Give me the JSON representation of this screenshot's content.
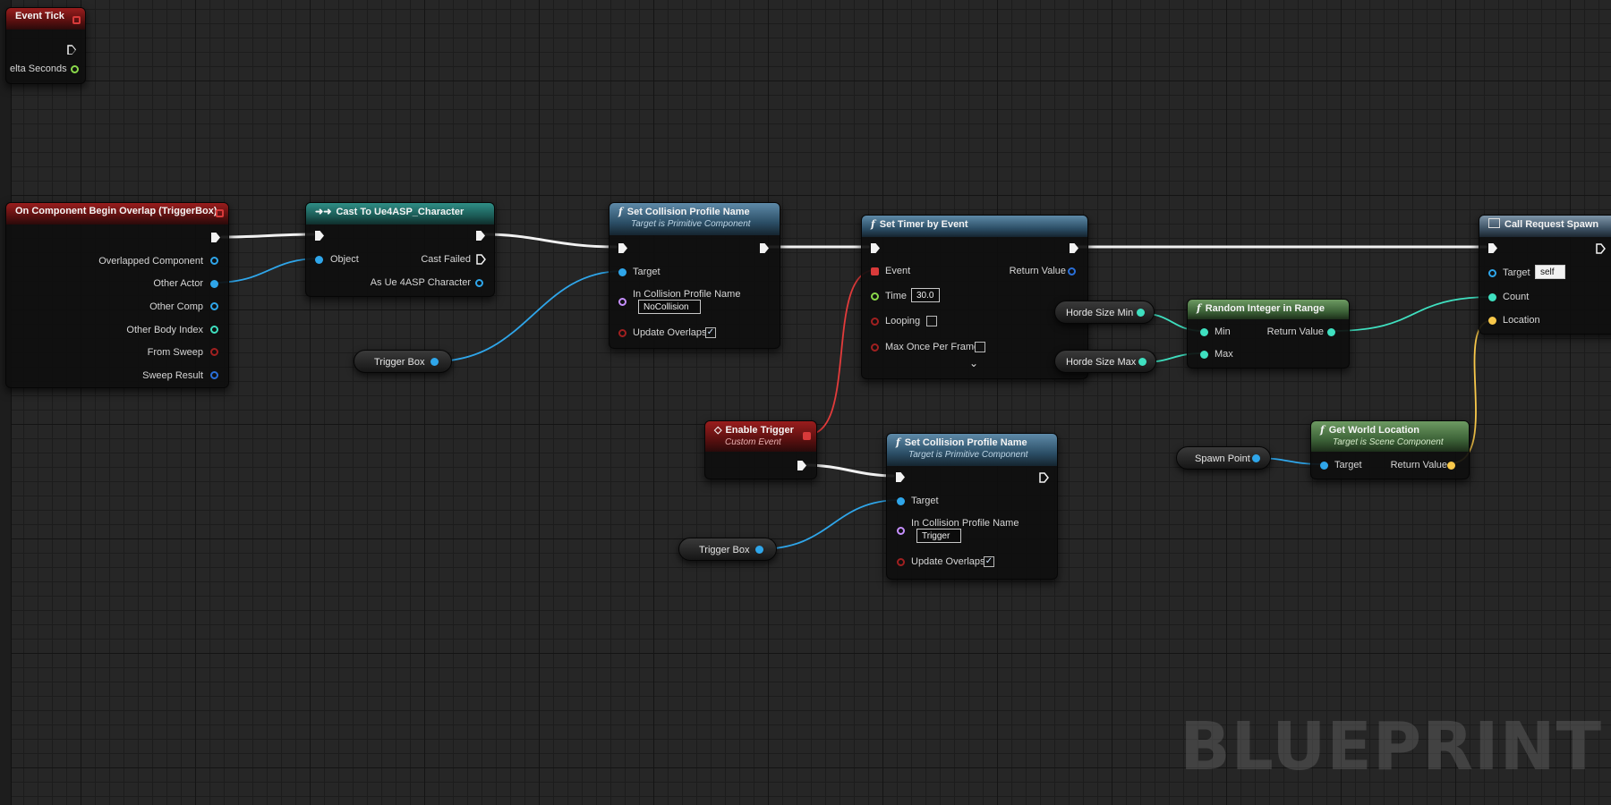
{
  "colors": {
    "exec": "#f2f2f2",
    "object": "#2fa6ea",
    "int": "#3fe0c0",
    "bool": "#a02020",
    "vector": "#f8c84a",
    "name": "#c690ff",
    "float": "#8ad84a",
    "delegate": "#e23b3b",
    "struct": "#2a6fd8"
  },
  "nodes": {
    "event_tick": {
      "title": "Event Tick",
      "pin_delta": "elta Seconds"
    },
    "overlap": {
      "title": "On Component Begin Overlap (TriggerBox)",
      "pins": [
        "Overlapped Component",
        "Other Actor",
        "Other Comp",
        "Other Body Index",
        "From Sweep",
        "Sweep Result"
      ]
    },
    "cast": {
      "title": "Cast To Ue4ASP_Character",
      "object": "Object",
      "cast_failed": "Cast Failed",
      "as_char": "As Ue 4ASP Character"
    },
    "set_collision_1": {
      "title": "Set Collision Profile Name",
      "subtitle": "Target is Primitive Component",
      "target": "Target",
      "profile_label": "In Collision Profile Name",
      "profile_value": "NoCollision",
      "update": "Update Overlaps"
    },
    "set_timer": {
      "title": "Set Timer by Event",
      "event": "Event",
      "return_value": "Return Value",
      "time": "Time",
      "time_value": "30.0",
      "looping": "Looping",
      "max_once": "Max Once Per Frame"
    },
    "call_request": {
      "title": "Call Request Spawn",
      "target": "Target",
      "target_value": "self",
      "count": "Count",
      "location": "Location"
    },
    "random_int": {
      "title": "Random Integer in Range",
      "min": "Min",
      "max": "Max",
      "return_value": "Return Value"
    },
    "enable_trigger": {
      "title": "Enable Trigger",
      "subtitle": "Custom Event"
    },
    "set_collision_2": {
      "title": "Set Collision Profile Name",
      "subtitle": "Target is Primitive Component",
      "target": "Target",
      "profile_label": "In Collision Profile Name",
      "profile_value": "Trigger",
      "update": "Update Overlaps"
    },
    "get_world_location": {
      "title": "Get World Location",
      "subtitle": "Target is Scene Component",
      "target": "Target",
      "return_value": "Return Value"
    }
  },
  "variables": {
    "trigger_box_1": "Trigger Box",
    "trigger_box_2": "Trigger Box",
    "horde_min": "Horde Size Min",
    "horde_max": "Horde Size Max",
    "spawn_point": "Spawn Point"
  },
  "checkboxes": {
    "update_overlaps_1": true,
    "update_overlaps_2": true,
    "looping": false,
    "max_once": false
  },
  "watermark": "BLUEPRINT"
}
